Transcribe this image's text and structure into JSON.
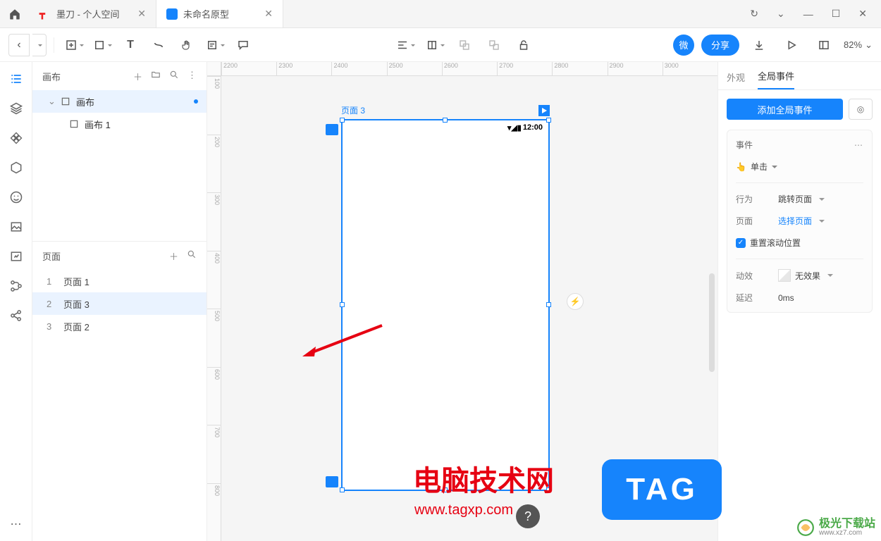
{
  "tabs": [
    {
      "title": "墨刀 - 个人空间",
      "icon_color": "#e22",
      "active": false
    },
    {
      "title": "未命名原型",
      "icon_color": "#1684fc",
      "active": true
    }
  ],
  "window_controls": {
    "reload": "⟳",
    "dropdown": "⌄",
    "min": "—",
    "max": "▢",
    "close": "✕"
  },
  "toolbar": {
    "zoom_label": "82%",
    "share_label": "分享",
    "badge_label": "微"
  },
  "left_panel": {
    "canvas_header": "画布",
    "tree": {
      "root": "画布",
      "children": [
        "画布 1"
      ]
    },
    "pages_header": "页面",
    "pages": [
      {
        "num": "1",
        "name": "页面 1"
      },
      {
        "num": "2",
        "name": "页面 3",
        "selected": true
      },
      {
        "num": "3",
        "name": "页面 2"
      }
    ]
  },
  "canvas": {
    "frame_label": "页面 3",
    "status_time": "12:00",
    "ruler_h": [
      "2200",
      "2300",
      "2400",
      "2500",
      "2600",
      "2700",
      "2800",
      "2900",
      "3000"
    ],
    "ruler_v": [
      "100",
      "200",
      "300",
      "400",
      "500",
      "600",
      "700",
      "800"
    ]
  },
  "right_panel": {
    "tabs": {
      "appearance": "外观",
      "events": "全局事件"
    },
    "add_event": "添加全局事件",
    "event_card": {
      "title": "事件",
      "trigger_label": "单击",
      "action_k": "行为",
      "action_v": "跳转页面",
      "page_k": "页面",
      "page_v": "选择页面",
      "reset_scroll": "重置滚动位置",
      "anim_k": "动效",
      "anim_v": "无效果",
      "delay_k": "延迟",
      "delay_v": "0ms"
    }
  },
  "watermarks": {
    "w1": "电脑技术网",
    "w1_sub": "www.tagxp.com",
    "tag": "TAG",
    "w2": "极光下载站",
    "w2_sub": "www.xz7.com"
  }
}
